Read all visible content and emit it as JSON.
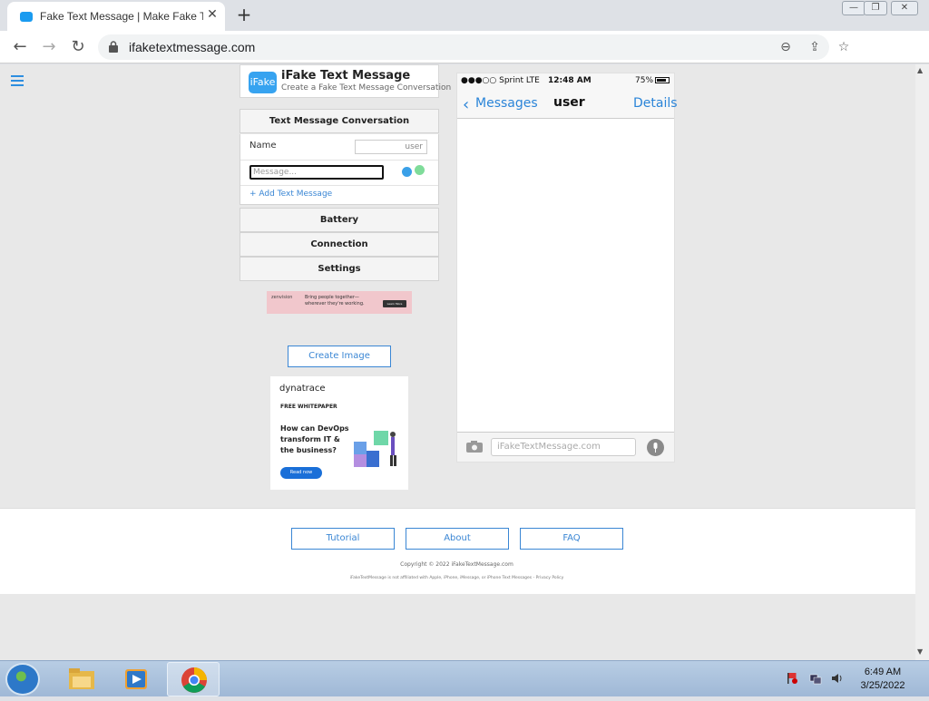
{
  "browser": {
    "tab_title": "Fake Text Message | Make Fake Text",
    "tab_close": "✕",
    "new_tab": "+",
    "url": "ifaketextmessage.com",
    "window_controls": [
      "—",
      "❐",
      "✕"
    ]
  },
  "page": {
    "logo": {
      "badge": "iFake",
      "title": "iFake Text Message",
      "subtitle": "Create a Fake Text Message Conversation"
    },
    "conversation": {
      "header": "Text Message Conversation",
      "name_label": "Name",
      "name_value": "user",
      "message_placeholder": "Message...",
      "add_message": "+ Add Text Message"
    },
    "sections": [
      "Battery",
      "Connection",
      "Settings"
    ],
    "ad_banner": {
      "brand": "zenvision",
      "text": "Bring people together—wherever they're working.",
      "cta": "Learn More"
    },
    "create_image": "Create Image",
    "ad_dynatrace": {
      "brand": "dynatrace",
      "tag": "FREE WHITEPAPER",
      "headline": "How can DevOps transform IT & the business?",
      "cta": "Read now"
    }
  },
  "phone": {
    "carrier": "●●●○○ Sprint  LTE",
    "time": "12:48 AM",
    "battery_pct": "75%",
    "battery_level": 0.75,
    "back_label": "Messages",
    "contact": "user",
    "details": "Details",
    "compose_placeholder": "iFakeTextMessage.com"
  },
  "footer": {
    "buttons": [
      "Tutorial",
      "About",
      "FAQ"
    ],
    "copyright": "Copyright © 2022 iFakeTextMessage.com",
    "disclaimer": "iFakeTextMessage is not affiliated with Apple, iPhone, iMessage, or iPhone Text Messages - Privacy Policy"
  },
  "taskbar": {
    "time": "6:49 AM",
    "date": "3/25/2022"
  },
  "colors": {
    "accent": "#3a86d4",
    "ios_blue": "#2a84d8",
    "brand_blue": "#37a3f0"
  }
}
